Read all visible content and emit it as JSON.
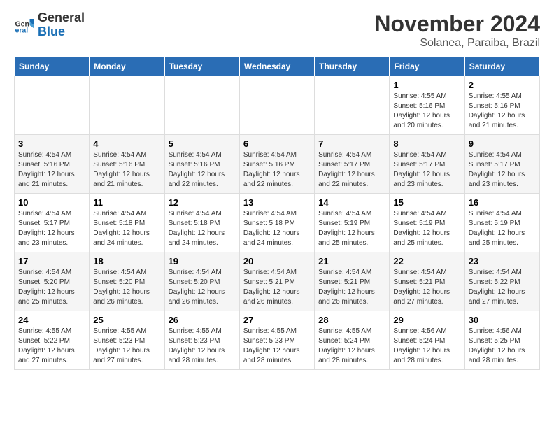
{
  "logo": {
    "line1": "General",
    "line2": "Blue"
  },
  "title": "November 2024",
  "subtitle": "Solanea, Paraiba, Brazil",
  "days_of_week": [
    "Sunday",
    "Monday",
    "Tuesday",
    "Wednesday",
    "Thursday",
    "Friday",
    "Saturday"
  ],
  "weeks": [
    [
      {
        "day": "",
        "info": ""
      },
      {
        "day": "",
        "info": ""
      },
      {
        "day": "",
        "info": ""
      },
      {
        "day": "",
        "info": ""
      },
      {
        "day": "",
        "info": ""
      },
      {
        "day": "1",
        "info": "Sunrise: 4:55 AM\nSunset: 5:16 PM\nDaylight: 12 hours and 20 minutes."
      },
      {
        "day": "2",
        "info": "Sunrise: 4:55 AM\nSunset: 5:16 PM\nDaylight: 12 hours and 21 minutes."
      }
    ],
    [
      {
        "day": "3",
        "info": "Sunrise: 4:54 AM\nSunset: 5:16 PM\nDaylight: 12 hours and 21 minutes."
      },
      {
        "day": "4",
        "info": "Sunrise: 4:54 AM\nSunset: 5:16 PM\nDaylight: 12 hours and 21 minutes."
      },
      {
        "day": "5",
        "info": "Sunrise: 4:54 AM\nSunset: 5:16 PM\nDaylight: 12 hours and 22 minutes."
      },
      {
        "day": "6",
        "info": "Sunrise: 4:54 AM\nSunset: 5:16 PM\nDaylight: 12 hours and 22 minutes."
      },
      {
        "day": "7",
        "info": "Sunrise: 4:54 AM\nSunset: 5:17 PM\nDaylight: 12 hours and 22 minutes."
      },
      {
        "day": "8",
        "info": "Sunrise: 4:54 AM\nSunset: 5:17 PM\nDaylight: 12 hours and 23 minutes."
      },
      {
        "day": "9",
        "info": "Sunrise: 4:54 AM\nSunset: 5:17 PM\nDaylight: 12 hours and 23 minutes."
      }
    ],
    [
      {
        "day": "10",
        "info": "Sunrise: 4:54 AM\nSunset: 5:17 PM\nDaylight: 12 hours and 23 minutes."
      },
      {
        "day": "11",
        "info": "Sunrise: 4:54 AM\nSunset: 5:18 PM\nDaylight: 12 hours and 24 minutes."
      },
      {
        "day": "12",
        "info": "Sunrise: 4:54 AM\nSunset: 5:18 PM\nDaylight: 12 hours and 24 minutes."
      },
      {
        "day": "13",
        "info": "Sunrise: 4:54 AM\nSunset: 5:18 PM\nDaylight: 12 hours and 24 minutes."
      },
      {
        "day": "14",
        "info": "Sunrise: 4:54 AM\nSunset: 5:19 PM\nDaylight: 12 hours and 25 minutes."
      },
      {
        "day": "15",
        "info": "Sunrise: 4:54 AM\nSunset: 5:19 PM\nDaylight: 12 hours and 25 minutes."
      },
      {
        "day": "16",
        "info": "Sunrise: 4:54 AM\nSunset: 5:19 PM\nDaylight: 12 hours and 25 minutes."
      }
    ],
    [
      {
        "day": "17",
        "info": "Sunrise: 4:54 AM\nSunset: 5:20 PM\nDaylight: 12 hours and 25 minutes."
      },
      {
        "day": "18",
        "info": "Sunrise: 4:54 AM\nSunset: 5:20 PM\nDaylight: 12 hours and 26 minutes."
      },
      {
        "day": "19",
        "info": "Sunrise: 4:54 AM\nSunset: 5:20 PM\nDaylight: 12 hours and 26 minutes."
      },
      {
        "day": "20",
        "info": "Sunrise: 4:54 AM\nSunset: 5:21 PM\nDaylight: 12 hours and 26 minutes."
      },
      {
        "day": "21",
        "info": "Sunrise: 4:54 AM\nSunset: 5:21 PM\nDaylight: 12 hours and 26 minutes."
      },
      {
        "day": "22",
        "info": "Sunrise: 4:54 AM\nSunset: 5:21 PM\nDaylight: 12 hours and 27 minutes."
      },
      {
        "day": "23",
        "info": "Sunrise: 4:54 AM\nSunset: 5:22 PM\nDaylight: 12 hours and 27 minutes."
      }
    ],
    [
      {
        "day": "24",
        "info": "Sunrise: 4:55 AM\nSunset: 5:22 PM\nDaylight: 12 hours and 27 minutes."
      },
      {
        "day": "25",
        "info": "Sunrise: 4:55 AM\nSunset: 5:23 PM\nDaylight: 12 hours and 27 minutes."
      },
      {
        "day": "26",
        "info": "Sunrise: 4:55 AM\nSunset: 5:23 PM\nDaylight: 12 hours and 28 minutes."
      },
      {
        "day": "27",
        "info": "Sunrise: 4:55 AM\nSunset: 5:23 PM\nDaylight: 12 hours and 28 minutes."
      },
      {
        "day": "28",
        "info": "Sunrise: 4:55 AM\nSunset: 5:24 PM\nDaylight: 12 hours and 28 minutes."
      },
      {
        "day": "29",
        "info": "Sunrise: 4:56 AM\nSunset: 5:24 PM\nDaylight: 12 hours and 28 minutes."
      },
      {
        "day": "30",
        "info": "Sunrise: 4:56 AM\nSunset: 5:25 PM\nDaylight: 12 hours and 28 minutes."
      }
    ]
  ]
}
